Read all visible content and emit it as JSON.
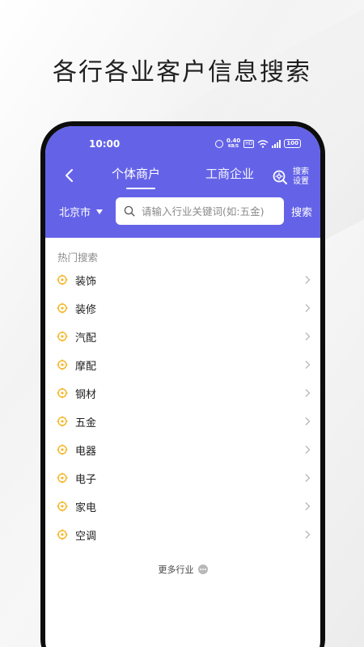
{
  "headline": "各行各业客户信息搜索",
  "status_bar": {
    "time": "10:00",
    "net_speed_value": "0.40",
    "net_speed_unit": "KB/S",
    "hd": "HD",
    "battery": "100"
  },
  "nav": {
    "tabs": [
      {
        "label": "个体商户",
        "active": true
      },
      {
        "label": "工商企业",
        "active": false
      }
    ],
    "settings_label": "搜索设置"
  },
  "search": {
    "city": "北京市",
    "placeholder": "请输入行业关键词(如:五金)",
    "button_label": "搜索"
  },
  "hot": {
    "title": "热门搜索",
    "items": [
      {
        "label": "装饰"
      },
      {
        "label": "装修"
      },
      {
        "label": "汽配"
      },
      {
        "label": "摩配"
      },
      {
        "label": "钢材"
      },
      {
        "label": "五金"
      },
      {
        "label": "电器"
      },
      {
        "label": "电子"
      },
      {
        "label": "家电"
      },
      {
        "label": "空调"
      }
    ]
  },
  "more_label": "更多行业",
  "colors": {
    "header": "#6463e8",
    "target_icon": "#f5b82e",
    "chevron": "#b5b5b5"
  },
  "icons": {
    "back": "chevron-left-icon",
    "settings": "search-settings-icon",
    "search": "search-icon",
    "item": "target-icon",
    "item_arrow": "chevron-right-icon",
    "more": "more-dots-icon"
  }
}
